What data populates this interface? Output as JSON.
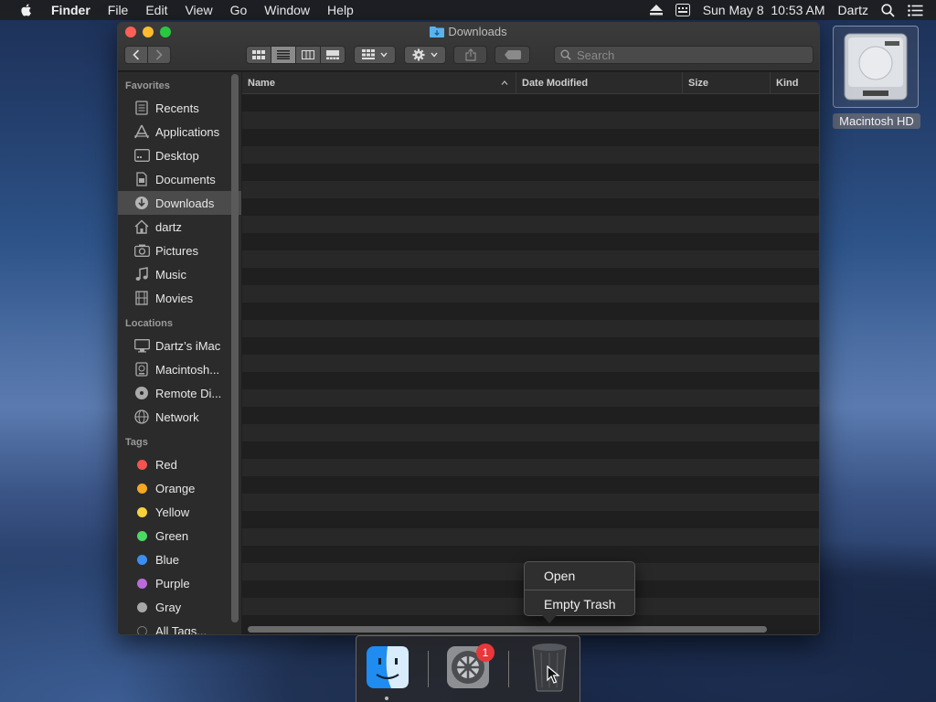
{
  "menubar": {
    "app_name": "Finder",
    "items": [
      "File",
      "Edit",
      "View",
      "Go",
      "Window",
      "Help"
    ],
    "datetime": "Sun May 8  10:53 AM",
    "user": "Dartz",
    "icons": [
      "apple-icon",
      "eject-icon",
      "input-menu-icon",
      "spotlight-icon",
      "notification-center-icon"
    ]
  },
  "window": {
    "title": "Downloads",
    "search": {
      "placeholder": "Search",
      "value": ""
    }
  },
  "sidebar": {
    "favorites_header": "Favorites",
    "favorites": [
      {
        "label": "Recents",
        "icon": "recents-icon"
      },
      {
        "label": "Applications",
        "icon": "applications-icon"
      },
      {
        "label": "Desktop",
        "icon": "desktop-icon"
      },
      {
        "label": "Documents",
        "icon": "documents-icon"
      },
      {
        "label": "Downloads",
        "icon": "downloads-icon",
        "selected": true
      },
      {
        "label": "dartz",
        "icon": "home-icon"
      },
      {
        "label": "Pictures",
        "icon": "pictures-icon"
      },
      {
        "label": "Music",
        "icon": "music-icon"
      },
      {
        "label": "Movies",
        "icon": "movies-icon"
      }
    ],
    "locations_header": "Locations",
    "locations": [
      {
        "label": "Dartz’s iMac",
        "icon": "imac-icon"
      },
      {
        "label": "Macintosh...",
        "icon": "hard-drive-icon"
      },
      {
        "label": "Remote Di...",
        "icon": "remote-disc-icon"
      },
      {
        "label": "Network",
        "icon": "network-icon"
      }
    ],
    "tags_header": "Tags",
    "tags": [
      {
        "label": "Red",
        "color": "#f2544f"
      },
      {
        "label": "Orange",
        "color": "#f5a623"
      },
      {
        "label": "Yellow",
        "color": "#f6d33c"
      },
      {
        "label": "Green",
        "color": "#4cd964"
      },
      {
        "label": "Blue",
        "color": "#3b8ff0"
      },
      {
        "label": "Purple",
        "color": "#bb6bd9"
      },
      {
        "label": "Gray",
        "color": "#a8a8a8"
      }
    ],
    "all_tags": "All Tags..."
  },
  "columns": {
    "name": "Name",
    "date_modified": "Date Modified",
    "size": "Size",
    "kind": "Kind"
  },
  "context_menu": {
    "open": "Open",
    "empty_trash": "Empty Trash"
  },
  "dock": {
    "badge_count": "1"
  },
  "desktop": {
    "drive_label": "Macintosh HD"
  }
}
